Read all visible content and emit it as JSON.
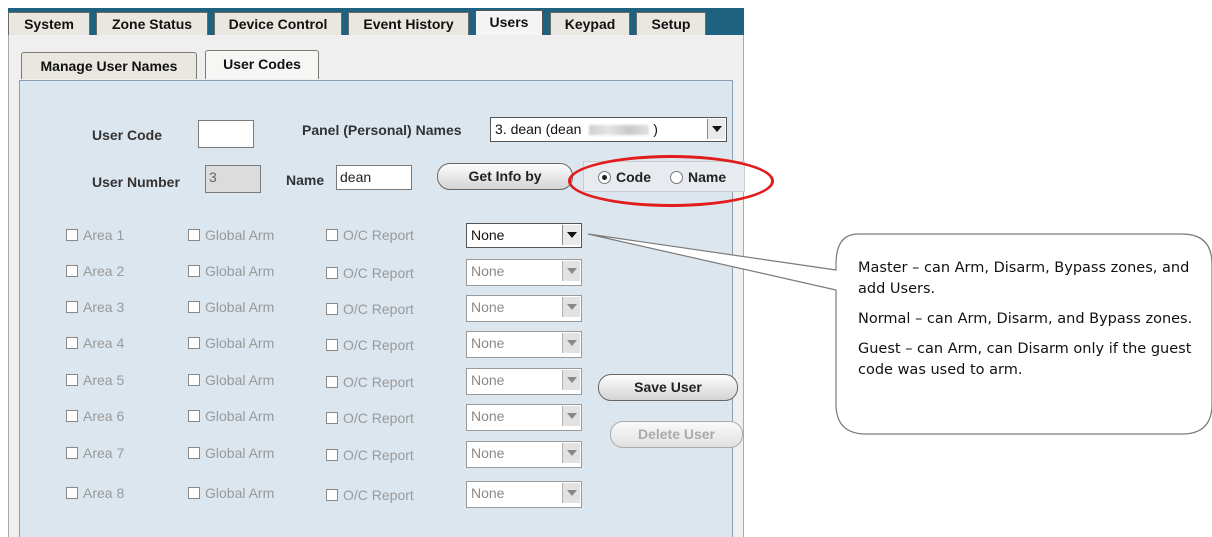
{
  "top_tabs": [
    "System",
    "Zone Status",
    "Device Control",
    "Event History",
    "Users",
    "Keypad",
    "Setup"
  ],
  "active_top_tab": "Users",
  "sub_tabs": [
    "Manage User Names",
    "User Codes"
  ],
  "active_sub_tab": "User Codes",
  "form": {
    "user_code_label": "User Code",
    "user_code_value": "",
    "panel_names_label": "Panel (Personal) Names",
    "panel_names_value": "3. dean (dean",
    "user_number_label": "User Number",
    "user_number_value": "3",
    "name_label": "Name",
    "name_value": "dean",
    "get_info_button": "Get Info by",
    "radio_code": "Code",
    "radio_name": "Name",
    "radio_selected": "Code"
  },
  "areas": [
    {
      "area": "Area 1",
      "global": "Global Arm",
      "report": "O/C Report",
      "level": "None"
    },
    {
      "area": "Area 2",
      "global": "Global Arm",
      "report": "O/C Report",
      "level": "None"
    },
    {
      "area": "Area 3",
      "global": "Global Arm",
      "report": "O/C Report",
      "level": "None"
    },
    {
      "area": "Area 4",
      "global": "Global Arm",
      "report": "O/C Report",
      "level": "None"
    },
    {
      "area": "Area 5",
      "global": "Global Arm",
      "report": "O/C Report",
      "level": "None"
    },
    {
      "area": "Area 6",
      "global": "Global Arm",
      "report": "O/C Report",
      "level": "None"
    },
    {
      "area": "Area 7",
      "global": "Global Arm",
      "report": "O/C Report",
      "level": "None"
    },
    {
      "area": "Area 8",
      "global": "Global Arm",
      "report": "O/C Report",
      "level": "None"
    }
  ],
  "buttons": {
    "save_user": "Save User",
    "delete_user": "Delete User"
  },
  "callout": {
    "master": "Master – can Arm, Disarm, Bypass zones, and add Users.",
    "normal": "Normal – can Arm, Disarm, and Bypass zones.",
    "guest": "Guest – can Arm, can Disarm only if the guest code was used to arm."
  },
  "colors": {
    "tab_bar": "#1f6180",
    "highlight_ellipse": "#e21b1b",
    "panel_inner": "#dbe6ef"
  }
}
